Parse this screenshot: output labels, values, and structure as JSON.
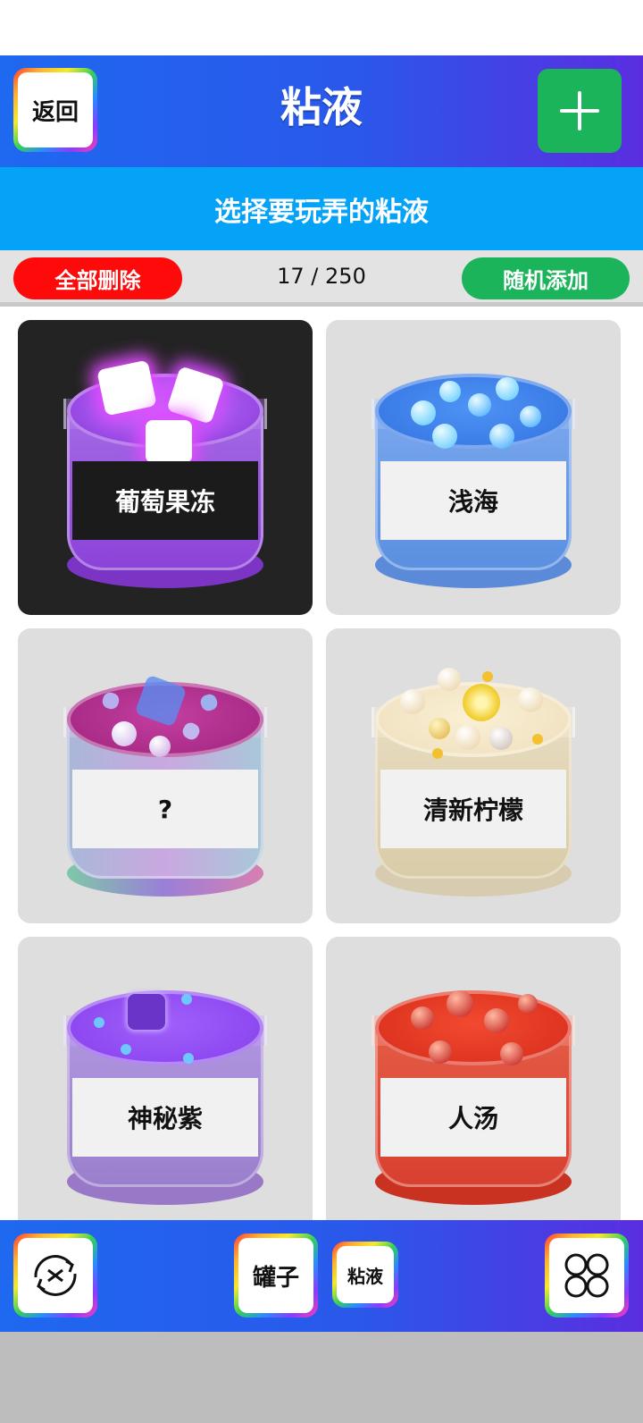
{
  "header": {
    "back_label": "返回",
    "title": "粘液",
    "add_icon": "plus-icon"
  },
  "subtitle": "选择要玩弄的粘液",
  "toolbar": {
    "delete_all_label": "全部删除",
    "count": "17 / 250",
    "random_add_label": "随机添加"
  },
  "slimes": [
    {
      "label": "葡萄果冻",
      "selected": true,
      "color": "#8b3fd6"
    },
    {
      "label": "浅海",
      "selected": false,
      "color": "#5b8fe0"
    },
    {
      "label": "?",
      "selected": false,
      "color": "#b53b9a"
    },
    {
      "label": "清新柠檬",
      "selected": false,
      "color": "#efe3c6"
    },
    {
      "label": "神秘紫",
      "selected": false,
      "color": "#9150f0"
    },
    {
      "label": "人汤",
      "selected": false,
      "color": "#e0392a"
    }
  ],
  "bottom_nav": {
    "reset_icon": "cycle-reset-icon",
    "jar_label": "罐子",
    "slime_label": "粘液",
    "grid_icon": "four-circles-icon"
  },
  "colors": {
    "header_gradient_start": "#1f68f0",
    "header_gradient_end": "#5a2ee0",
    "subtitle_bg": "#04a3f8",
    "delete_red": "#ff0a0a",
    "add_green": "#1bb45a"
  }
}
